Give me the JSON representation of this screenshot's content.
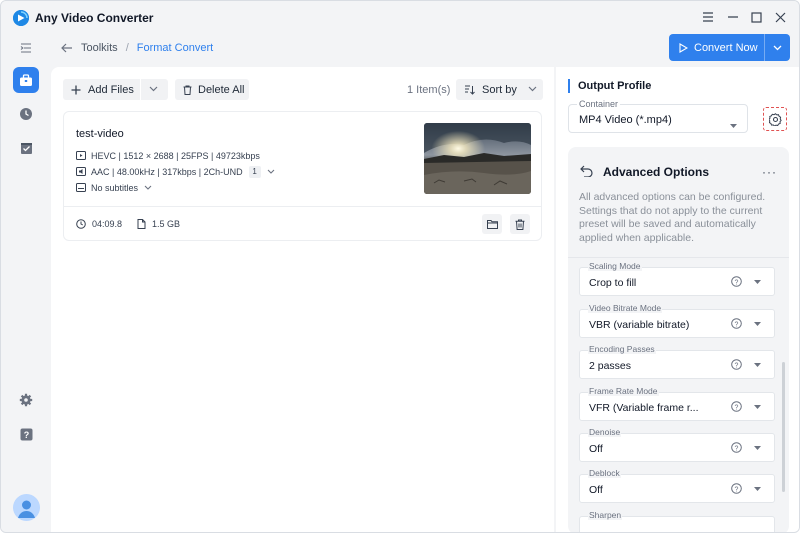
{
  "app": {
    "title": "Any Video Converter"
  },
  "window_controls": {
    "menu_icon": "hamburger-icon",
    "minimize_icon": "minimize-icon",
    "maximize_icon": "maximize-icon",
    "close_icon": "close-icon"
  },
  "nav": {
    "items": [
      {
        "name": "collapse-sidebar-icon"
      },
      {
        "name": "toolkits-icon",
        "active": true
      },
      {
        "name": "history-icon"
      },
      {
        "name": "tasks-icon"
      },
      {
        "name": "settings-icon"
      },
      {
        "name": "help-icon"
      }
    ]
  },
  "breadcrumb": {
    "back_icon": "back-arrow-icon",
    "parent": "Toolkits",
    "separator": "/",
    "current": "Format Convert"
  },
  "convert": {
    "label": "Convert Now"
  },
  "toolbar": {
    "add_files": "Add Files",
    "delete_all": "Delete All",
    "count": "1 Item(s)",
    "sort_by": "Sort by"
  },
  "file": {
    "name": "test-video",
    "video_info": "HEVC | 1512 × 2688 | 25FPS | 49723kbps",
    "audio_info": "AAC | 48.00kHz | 317kbps | 2Ch-UND",
    "audio_tracks": "1",
    "subtitles": "No subtitles",
    "duration": "04:09.8",
    "size": "1.5 GB"
  },
  "output_profile": {
    "title": "Output Profile",
    "container_label": "Container",
    "container_value": "MP4 Video (*.mp4)"
  },
  "advanced": {
    "title": "Advanced Options",
    "more": "···",
    "description": "All advanced options can be configured. Settings that do not apply to the current preset will be saved and automatically applied when applicable.",
    "options": [
      {
        "label": "Scaling Mode",
        "value": "Crop to fill"
      },
      {
        "label": "Video Bitrate Mode",
        "value": "VBR (variable bitrate)"
      },
      {
        "label": "Encoding Passes",
        "value": "2 passes"
      },
      {
        "label": "Frame Rate Mode",
        "value": "VFR (Variable frame r..."
      },
      {
        "label": "Denoise",
        "value": "Off"
      },
      {
        "label": "Deblock",
        "value": "Off"
      },
      {
        "label": "Sharpen",
        "value": ""
      }
    ]
  },
  "colors": {
    "accent": "#2f80ed",
    "panel": "#f3f4f6",
    "highlight_border": "#e05252"
  }
}
